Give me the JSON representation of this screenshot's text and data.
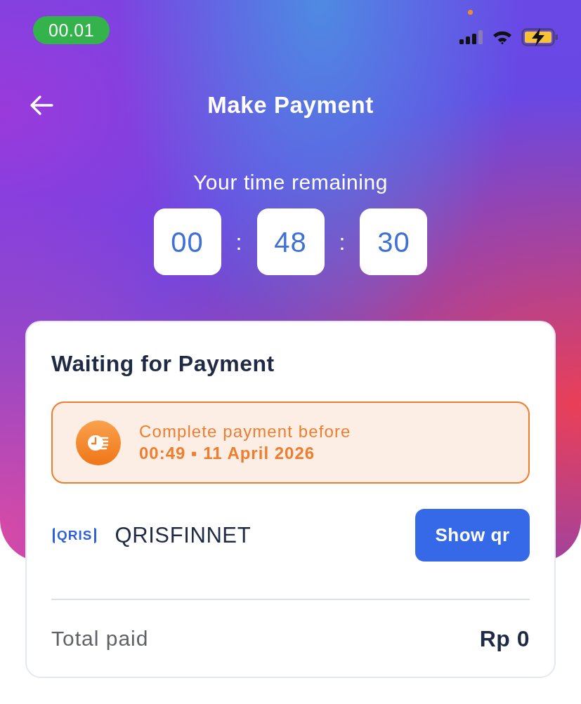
{
  "status_bar": {
    "time": "00.01",
    "battery_charging": true
  },
  "header": {
    "title": "Make Payment"
  },
  "countdown": {
    "label": "Your time remaining",
    "segments": [
      "00",
      "48",
      "30"
    ],
    "separators": [
      ":",
      ":"
    ]
  },
  "payment_card": {
    "title": "Waiting for Payment",
    "notice": {
      "label": "Complete payment before",
      "deadline": "00:49 ▪ 11 April 2026"
    },
    "method": {
      "logo": "QRIS",
      "name": "QRISFINNET",
      "button": "Show qr"
    },
    "total": {
      "label": "Total paid",
      "amount": "Rp 0"
    }
  }
}
